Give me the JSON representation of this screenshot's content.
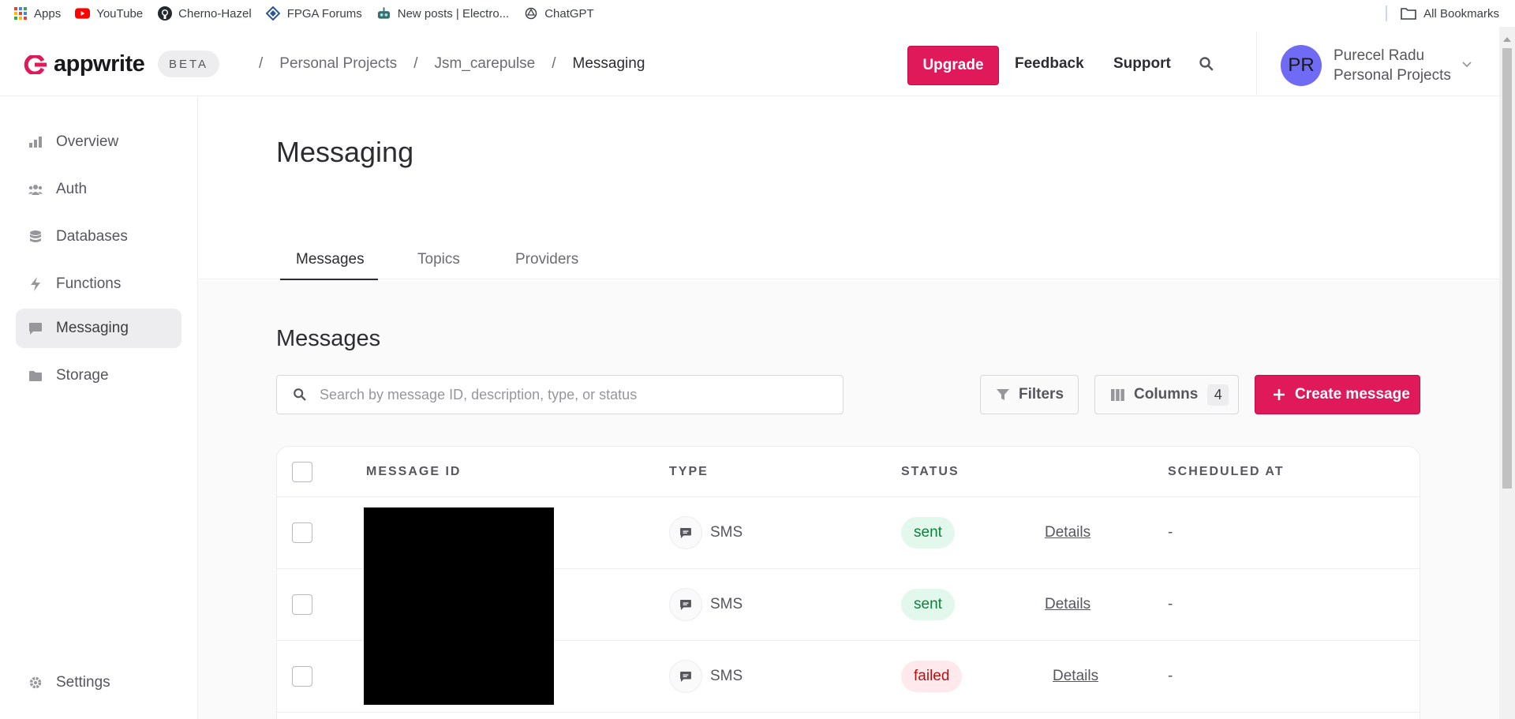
{
  "bookmarks": {
    "items": [
      {
        "label": "Apps",
        "icon": "apps-grid-icon"
      },
      {
        "label": "YouTube",
        "icon": "youtube-icon"
      },
      {
        "label": "Cherno-Hazel",
        "icon": "github-icon"
      },
      {
        "label": "FPGA Forums",
        "icon": "fpga-forum-icon"
      },
      {
        "label": "New posts | Electro...",
        "icon": "robot-icon"
      },
      {
        "label": "ChatGPT",
        "icon": "chatgpt-icon"
      }
    ],
    "all_bookmarks": "All Bookmarks"
  },
  "header": {
    "logo_text": "appwrite",
    "beta": "BETA",
    "breadcrumbs": [
      "Personal Projects",
      "Jsm_carepulse",
      "Messaging"
    ],
    "separator": "/",
    "upgrade": "Upgrade",
    "feedback": "Feedback",
    "support": "Support",
    "avatar_initials": "PR",
    "user_name": "Purecel Radu",
    "user_org": "Personal Projects"
  },
  "sidebar": {
    "items": [
      {
        "label": "Overview",
        "icon": "chart-icon"
      },
      {
        "label": "Auth",
        "icon": "users-icon"
      },
      {
        "label": "Databases",
        "icon": "database-icon"
      },
      {
        "label": "Functions",
        "icon": "lightning-icon"
      },
      {
        "label": "Messaging",
        "icon": "message-icon",
        "active": true
      },
      {
        "label": "Storage",
        "icon": "folder-icon"
      }
    ],
    "settings": "Settings"
  },
  "page": {
    "title": "Messaging",
    "tabs": [
      "Messages",
      "Topics",
      "Providers"
    ],
    "active_tab": "Messages",
    "section_title": "Messages",
    "search_placeholder": "Search by message ID, description, type, or status",
    "filters": "Filters",
    "columns": "Columns",
    "columns_count": "4",
    "create": "Create message"
  },
  "table": {
    "headers": [
      "MESSAGE ID",
      "TYPE",
      "STATUS",
      "SCHEDULED AT"
    ],
    "rows": [
      {
        "type": "SMS",
        "status": "sent",
        "details": "Details",
        "scheduled": "-"
      },
      {
        "type": "SMS",
        "status": "sent",
        "details": "Details",
        "scheduled": "-"
      },
      {
        "type": "SMS",
        "status": "failed",
        "details": "Details",
        "scheduled": "-"
      }
    ]
  },
  "colors": {
    "accent": "#e0195a",
    "avatar": "#6f6bf5",
    "sent_bg": "#e2f8ec",
    "failed_bg": "#ffe9ec"
  }
}
